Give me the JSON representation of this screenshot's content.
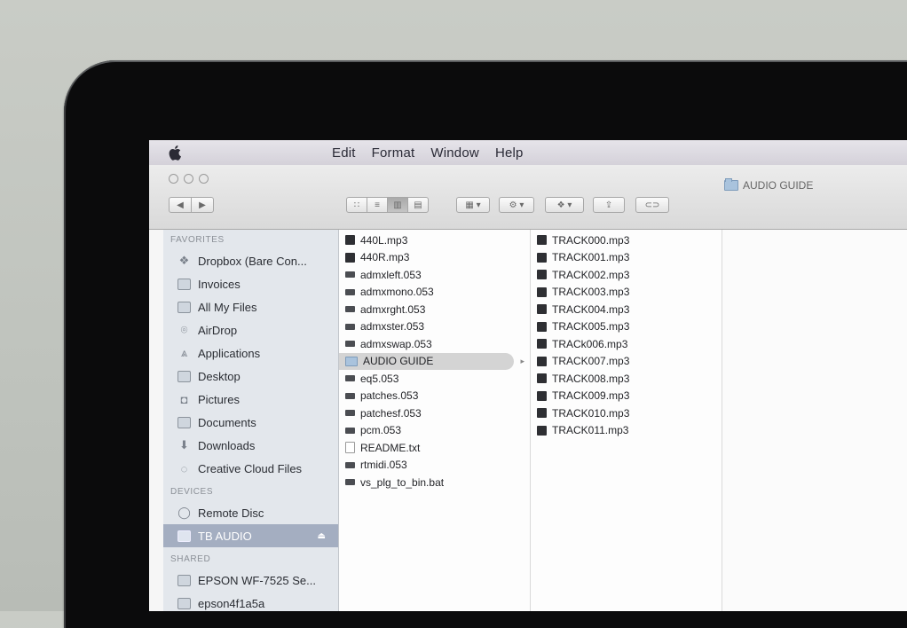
{
  "menubar": {
    "items": [
      "Edit",
      "Format",
      "Window",
      "Help"
    ]
  },
  "window": {
    "title": "AUDIO GUIDE",
    "toolbar": {
      "back": "◀",
      "forward": "▶",
      "view_icons": "∷",
      "view_list": "≡",
      "view_columns": "▥",
      "view_coverflow": "▤",
      "arrange": "▦ ▾",
      "action": "⚙ ▾",
      "dropbox": "❖ ▾",
      "share": "⇪",
      "tags": "⊂⊃"
    }
  },
  "sidebar": {
    "favorites_header": "FAVORITES",
    "favorites": [
      {
        "label": "Dropbox (Bare Con...",
        "icon": "dropbox-icon"
      },
      {
        "label": "Invoices",
        "icon": "folder-icon"
      },
      {
        "label": "All My Files",
        "icon": "all-files-icon"
      },
      {
        "label": "AirDrop",
        "icon": "airdrop-icon"
      },
      {
        "label": "Applications",
        "icon": "applications-icon"
      },
      {
        "label": "Desktop",
        "icon": "desktop-icon"
      },
      {
        "label": "Pictures",
        "icon": "camera-icon"
      },
      {
        "label": "Documents",
        "icon": "documents-icon"
      },
      {
        "label": "Downloads",
        "icon": "downloads-icon"
      },
      {
        "label": "Creative Cloud Files",
        "icon": "creative-cloud-icon"
      }
    ],
    "devices_header": "DEVICES",
    "devices": [
      {
        "label": "Remote Disc",
        "icon": "disc-icon"
      },
      {
        "label": "TB AUDIO",
        "icon": "drive-icon",
        "selected": true
      }
    ],
    "shared_header": "SHARED",
    "shared": [
      {
        "label": "EPSON WF-7525 Se...",
        "icon": "monitor-icon"
      },
      {
        "label": "epson4f1a5a",
        "icon": "monitor-icon"
      }
    ]
  },
  "column1": [
    {
      "name": "440L.mp3",
      "type": "mp3"
    },
    {
      "name": "440R.mp3",
      "type": "mp3"
    },
    {
      "name": "admxleft.053",
      "type": "bin"
    },
    {
      "name": "admxmono.053",
      "type": "bin"
    },
    {
      "name": "admxrght.053",
      "type": "bin"
    },
    {
      "name": "admxster.053",
      "type": "bin"
    },
    {
      "name": "admxswap.053",
      "type": "bin"
    },
    {
      "name": "AUDIO GUIDE",
      "type": "folder",
      "selected": true
    },
    {
      "name": "eq5.053",
      "type": "bin"
    },
    {
      "name": "patches.053",
      "type": "bin"
    },
    {
      "name": "patchesf.053",
      "type": "bin"
    },
    {
      "name": "pcm.053",
      "type": "bin"
    },
    {
      "name": "README.txt",
      "type": "doc"
    },
    {
      "name": "rtmidi.053",
      "type": "bin"
    },
    {
      "name": "vs_plg_to_bin.bat",
      "type": "bin"
    }
  ],
  "column2": [
    {
      "name": "TRACK000.mp3",
      "type": "mp3"
    },
    {
      "name": "TRACK001.mp3",
      "type": "mp3"
    },
    {
      "name": "TRACK002.mp3",
      "type": "mp3"
    },
    {
      "name": "TRACK003.mp3",
      "type": "mp3"
    },
    {
      "name": "TRACK004.mp3",
      "type": "mp3"
    },
    {
      "name": "TRACK005.mp3",
      "type": "mp3"
    },
    {
      "name": "TRACk006.mp3",
      "type": "mp3"
    },
    {
      "name": "TRACK007.mp3",
      "type": "mp3"
    },
    {
      "name": "TRACK008.mp3",
      "type": "mp3"
    },
    {
      "name": "TRACK009.mp3",
      "type": "mp3"
    },
    {
      "name": "TRACK010.mp3",
      "type": "mp3"
    },
    {
      "name": "TRACK011.mp3",
      "type": "mp3"
    }
  ]
}
